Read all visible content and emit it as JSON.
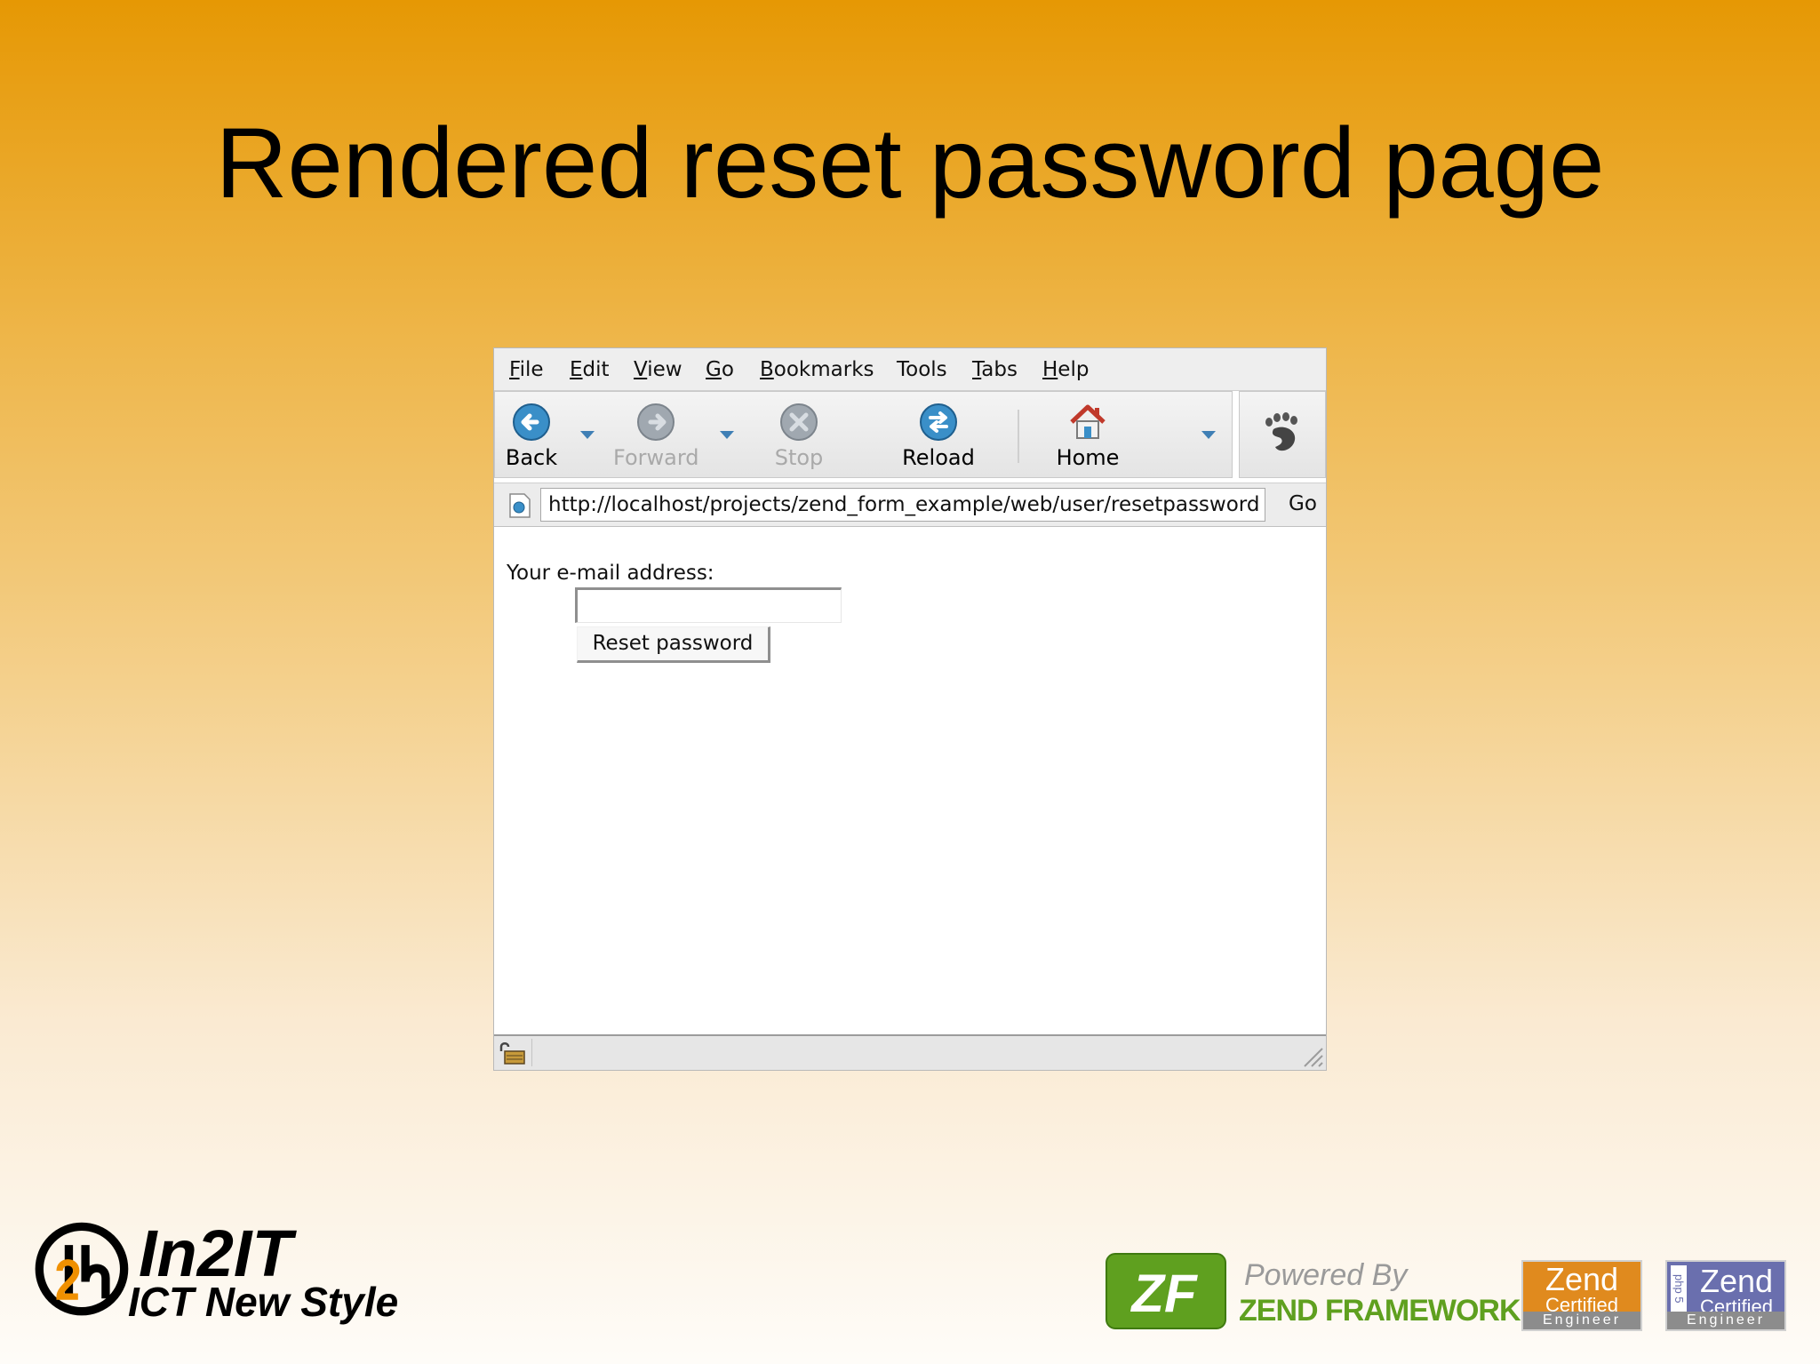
{
  "slide": {
    "title": "Rendered reset password page"
  },
  "browser": {
    "menu": [
      "File",
      "Edit",
      "View",
      "Go",
      "Bookmarks",
      "Tools",
      "Tabs",
      "Help"
    ],
    "toolbar": {
      "back": "Back",
      "forward": "Forward",
      "stop": "Stop",
      "reload": "Reload",
      "home": "Home"
    },
    "location": {
      "url": "http://localhost/projects/zend_form_example/web/user/resetpassword",
      "go": "Go"
    },
    "page": {
      "email_label": "Your e-mail address:",
      "email_value": "",
      "reset_button": "Reset password"
    },
    "colors": {
      "icon_blue": "#3a8fc8",
      "icon_gray": "#a0a8b0",
      "home_red": "#c0392b"
    }
  },
  "footer": {
    "in2it_name": "In2IT",
    "in2it_tagline": "ICT New Style",
    "powered_by": "Powered By",
    "zend_framework": "ZEND FRAMEWORK",
    "badge_zend": "Zend",
    "badge_certified": "Certified",
    "badge_engineer": "Engineer",
    "badge_php": "php 5"
  }
}
